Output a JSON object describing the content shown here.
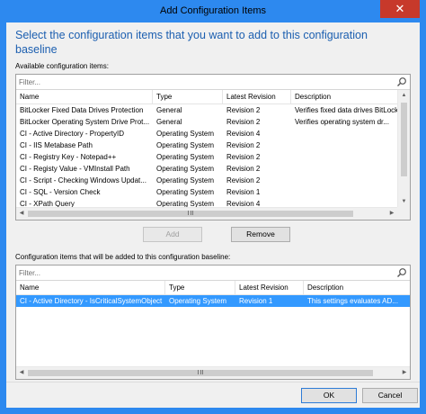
{
  "window": {
    "title": "Add Configuration Items",
    "close_glyph": "✕"
  },
  "heading": "Select the configuration items that you want to add to this configuration baseline",
  "available": {
    "label": "Available configuration items:",
    "filter_placeholder": "Filter...",
    "columns": [
      "Name",
      "Type",
      "Latest Revision",
      "Description"
    ],
    "rows": [
      [
        "BitLocker Fixed Data Drives Protection",
        "General",
        "Revision 2",
        "Verifies fixed data drives BitLocker..."
      ],
      [
        "BitLocker Operating System Drive Prot...",
        "General",
        "Revision 2",
        "Verifies operating system dr..."
      ],
      [
        "CI - Active Directory - PropertyID",
        "Operating System",
        "Revision 4",
        ""
      ],
      [
        "CI - IIS Metabase Path",
        "Operating System",
        "Revision 2",
        ""
      ],
      [
        "CI - Registry Key - Notepad++",
        "Operating System",
        "Revision 2",
        ""
      ],
      [
        "CI - Registy Value - VMInstall Path",
        "Operating System",
        "Revision 2",
        ""
      ],
      [
        "CI - Script - Checking Windows Updat...",
        "Operating System",
        "Revision 2",
        ""
      ],
      [
        "CI - SQL - Version Check",
        "Operating System",
        "Revision 1",
        ""
      ],
      [
        "CI - XPath Query",
        "Operating System",
        "Revision 4",
        ""
      ]
    ]
  },
  "buttons": {
    "add": "Add",
    "remove": "Remove",
    "ok": "OK",
    "cancel": "Cancel"
  },
  "added": {
    "label": "Configuration items that will be added to this configuration baseline:",
    "filter_placeholder": "Filter...",
    "columns": [
      "Name",
      "Type",
      "Latest Revision",
      "Description"
    ],
    "rows": [
      [
        "CI - Active Directory - IsCriticalSystemObject",
        "Operating System",
        "Revision 1",
        "This settings evaluates AD..."
      ]
    ]
  },
  "icons": {
    "search": "search-icon",
    "scroll_up": "▲",
    "scroll_down": "▼",
    "scroll_left": "◀",
    "scroll_right": "▶"
  },
  "colors": {
    "accent": "#2d89ef",
    "heading": "#1c5fb0",
    "selection": "#3399ff",
    "close": "#c7392b"
  }
}
